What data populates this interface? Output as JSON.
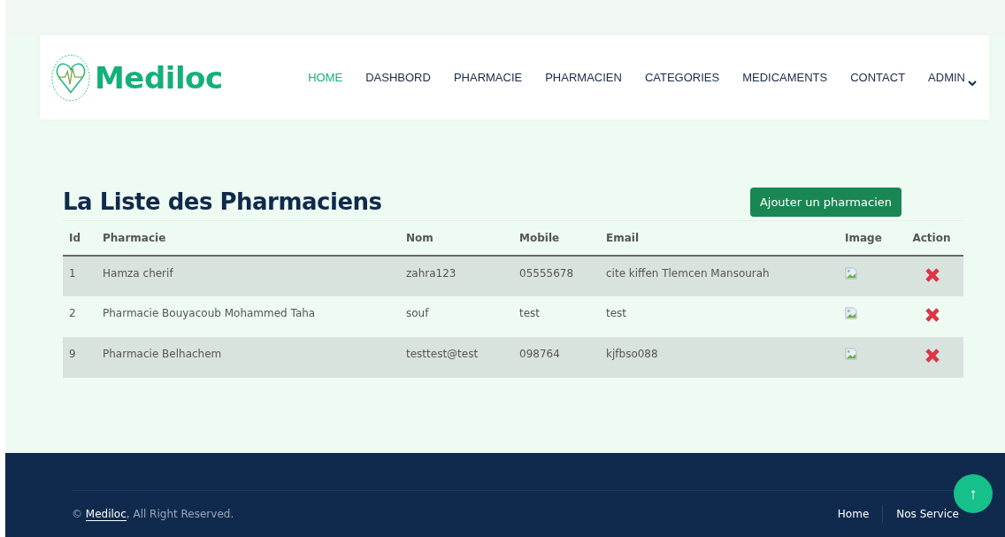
{
  "brand": {
    "name": "Mediloc"
  },
  "nav": [
    {
      "label": "HOME",
      "selected": true,
      "dropdown": false
    },
    {
      "label": "DASHBORD",
      "selected": false,
      "dropdown": false
    },
    {
      "label": "PHARMACIE",
      "selected": false,
      "dropdown": false
    },
    {
      "label": "PHARMACIEN",
      "selected": false,
      "dropdown": false
    },
    {
      "label": "CATEGORIES",
      "selected": false,
      "dropdown": false
    },
    {
      "label": "MEDICAMENTS",
      "selected": false,
      "dropdown": false
    },
    {
      "label": "CONTACT",
      "selected": false,
      "dropdown": false
    },
    {
      "label": "ADMIN",
      "selected": false,
      "dropdown": true
    }
  ],
  "page": {
    "title": "La Liste des Pharmaciens",
    "add_button": "Ajouter un pharmacien"
  },
  "table": {
    "columns": [
      "Id",
      "Pharmacie",
      "Nom",
      "Mobile",
      "Email",
      "Image",
      "Action"
    ],
    "rows": [
      {
        "cells": [
          "1",
          "Hamza cherif",
          "zahra123",
          "05555678",
          "cite kiffen Tlemcen Mansourah"
        ]
      },
      {
        "cells": [
          "2",
          "Pharmacie Bouyacoub Mohammed Taha",
          "souf",
          "test",
          "test"
        ]
      },
      {
        "cells": [
          "9",
          "Pharmacie Belhachem",
          "testtest@test",
          "098764",
          "kjfbso088"
        ]
      }
    ]
  },
  "footer": {
    "copyright_symbol": "©",
    "copyright_link": "Mediloc",
    "copyright_rest": ", All Right Reserved.",
    "links": [
      "Home",
      "Nos Service"
    ],
    "back_to_top": "↑"
  }
}
